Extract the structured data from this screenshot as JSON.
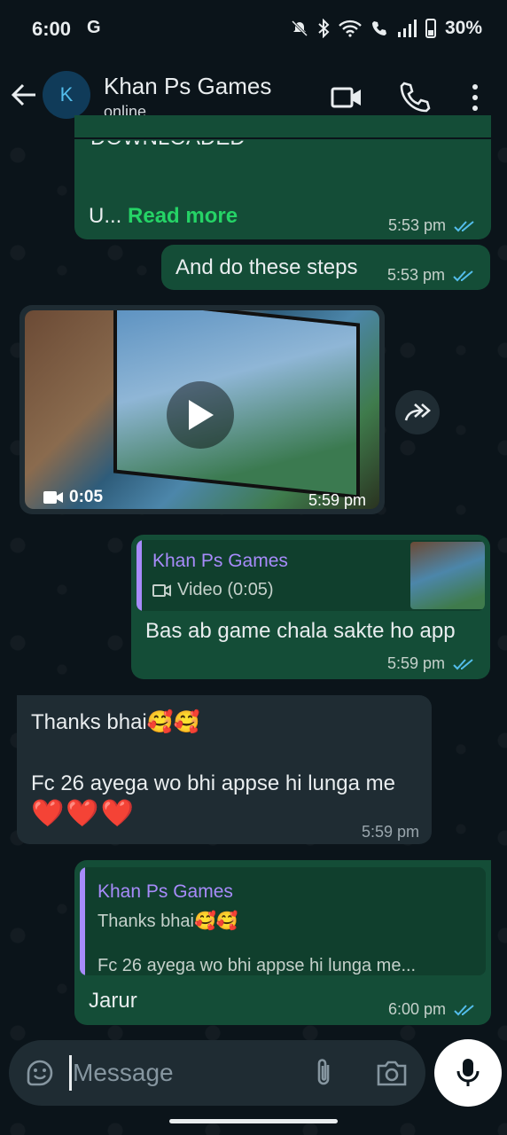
{
  "status_bar": {
    "time": "6:00",
    "left_icons": "G",
    "battery_percent": "30%"
  },
  "header": {
    "avatar_letter": "K",
    "contact_name": "Khan Ps Games",
    "contact_status": "online"
  },
  "messages": {
    "m1": {
      "clipped_text": "DOWNLOADED",
      "text_prefix": "U...",
      "read_more": "Read more",
      "time": "5:53 pm"
    },
    "m2": {
      "text": "And do these steps",
      "time": "5:53 pm"
    },
    "m3": {
      "duration": "0:05",
      "time": "5:59 pm"
    },
    "m4": {
      "quote_author": "Khan Ps Games",
      "quote_text": "Video (0:05)",
      "text": "Bas ab game chala sakte ho app",
      "time": "5:59 pm"
    },
    "m5": {
      "line1": "Thanks bhai🥰🥰",
      "line2": "Fc 26 ayega wo bhi appse hi lunga me",
      "hearts": "❤️❤️❤️",
      "time": "5:59 pm"
    },
    "m6": {
      "quote_author": "Khan Ps Games",
      "quote_line1": "Thanks bhai🥰🥰",
      "quote_line2": "Fc 26 ayega wo bhi appse hi lunga me...",
      "text": "Jarur",
      "time": "6:00 pm"
    }
  },
  "input": {
    "placeholder": "Message"
  },
  "colors": {
    "outgoing_bubble": "#144d37",
    "incoming_bubble": "#1f2c33",
    "read_more": "#25d366",
    "read_ticks": "#53bdeb",
    "quote_accent": "#a78bfa"
  },
  "icons": [
    "back-arrow-icon",
    "video-call-icon",
    "phone-icon",
    "more-vert-icon",
    "play-icon",
    "forward-icon",
    "video-camera-icon",
    "sticker-icon",
    "attach-icon",
    "camera-icon",
    "mic-icon",
    "double-tick-icon"
  ]
}
